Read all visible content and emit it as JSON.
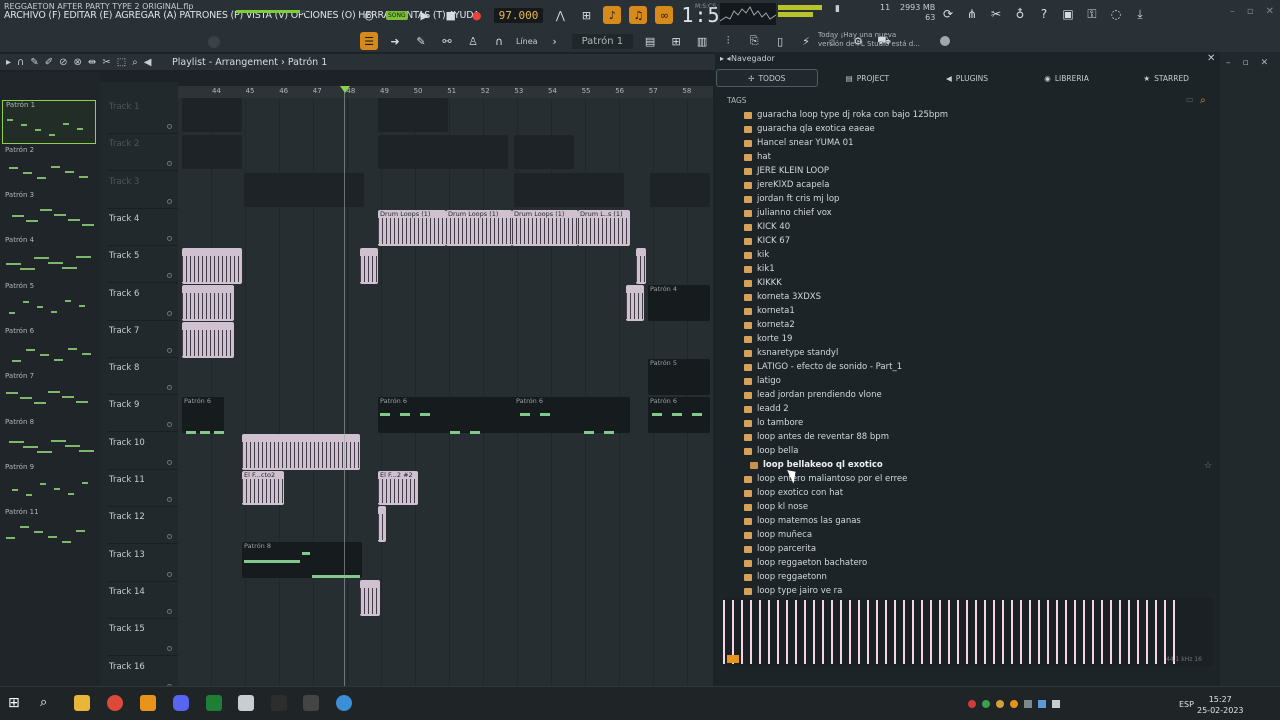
{
  "app": {
    "menu": "ARCHIVO (F) EDITAR (E) AGREGAR (A) PATRONES (P) VISTA (V) OPCIONES (O) HERRAMIENTAS (T) AYUDA",
    "filename": "REGGAETON AFTER PARTY TYPE 2 ORIGINAL.flp"
  },
  "transport": {
    "pat_label": "PAT",
    "song_label": "SONG",
    "bpm": "97.000",
    "time": "1:56:28",
    "time_units": "M:S:CS",
    "cpu_value": "11",
    "mem_mb": "2993 MB",
    "mem_val": "63"
  },
  "toolbar2": {
    "line_mode": "Línea",
    "pattern": "Patrón 1",
    "news_line1": "Today  ¡Hay una nueva",
    "news_line2": "versión de FL Studio está d..."
  },
  "playlist": {
    "title": "Playlist - Arrangement",
    "breadcrumb": "Patrón 1",
    "ruler": [
      "44",
      "45",
      "46",
      "47",
      "48",
      "49",
      "50",
      "51",
      "52",
      "53",
      "54",
      "55",
      "56",
      "57",
      "58"
    ],
    "tracks": [
      "Track 1",
      "Track 2",
      "Track 3",
      "Track 4",
      "Track 5",
      "Track 6",
      "Track 7",
      "Track 8",
      "Track 9",
      "Track 10",
      "Track 11",
      "Track 12",
      "Track 13",
      "Track 14",
      "Track 15",
      "Track 16"
    ],
    "clip_labels": {
      "p1": "Patrón 1",
      "p2": "Patrón 2",
      "p3": "Patrón 3",
      "p4": "Patrón 4",
      "p5": "Patrón 5",
      "p6": "Patrón 6",
      "p7": "Patrón 7",
      "p8": "Patrón 8",
      "drum": "Drum Loops (1)",
      "drum_short": "Drum L..s (1)",
      "elf1": "El F...cto2",
      "elf2": "El F...2 #2"
    }
  },
  "picker": {
    "patterns": [
      "Patrón 1",
      "Patrón 2",
      "Patrón 3",
      "Patrón 4",
      "Patrón 5",
      "Patrón 6",
      "Patrón 7",
      "Patrón 8",
      "Patrón 9",
      "Patrón 11"
    ]
  },
  "browser": {
    "title": "Navegador",
    "tabs": [
      "TODOS",
      "PROJECT",
      "PLUGINS",
      "LIBRERIA",
      "STARRED"
    ],
    "tags_label": "TAGS",
    "files": [
      "guaracha loop type dj roka con bajo 125bpm",
      "guaracha qla exotica eaeae",
      "Hancel snear  YUMA 01",
      "hat",
      "JERE KLEIN LOOP",
      "jereKlXD acapela",
      "jordan ft cris mj lop",
      "julianno chief vox",
      "KICK 40",
      "KICK 67",
      "kik",
      "kik1",
      "KIKKK",
      "korneta 3XDXS",
      "korneta1",
      "korneta2",
      "korte 19",
      "ksnaretype standyl",
      "LATIGO - efecto de sonido - Part_1",
      "latigo",
      "lead jordan prendiendo vlone",
      "leadd 2",
      "lo tambore",
      "loop antes de reventar 88 bpm",
      "loop bella",
      "loop bellakeoo ql exotico",
      "loop entero maliantoso por el erree",
      "loop exotico con hat",
      "loop kl nose",
      "loop matemos las ganas",
      "loop muñeca",
      "loop parcerita",
      "loop reggaeton bachatero",
      "loop reggaetonn",
      "loop type jairo ve ra"
    ],
    "wave_info": "44.1 kHz 16"
  },
  "taskbar": {
    "lang": "ESP",
    "time": "15:27",
    "date": "25-02-2023"
  },
  "colors": {
    "accent_orange": "#d58a1a",
    "audio_clip": "#cfc1cf",
    "note_green": "#85c88c",
    "folder": "#d6a25a"
  }
}
